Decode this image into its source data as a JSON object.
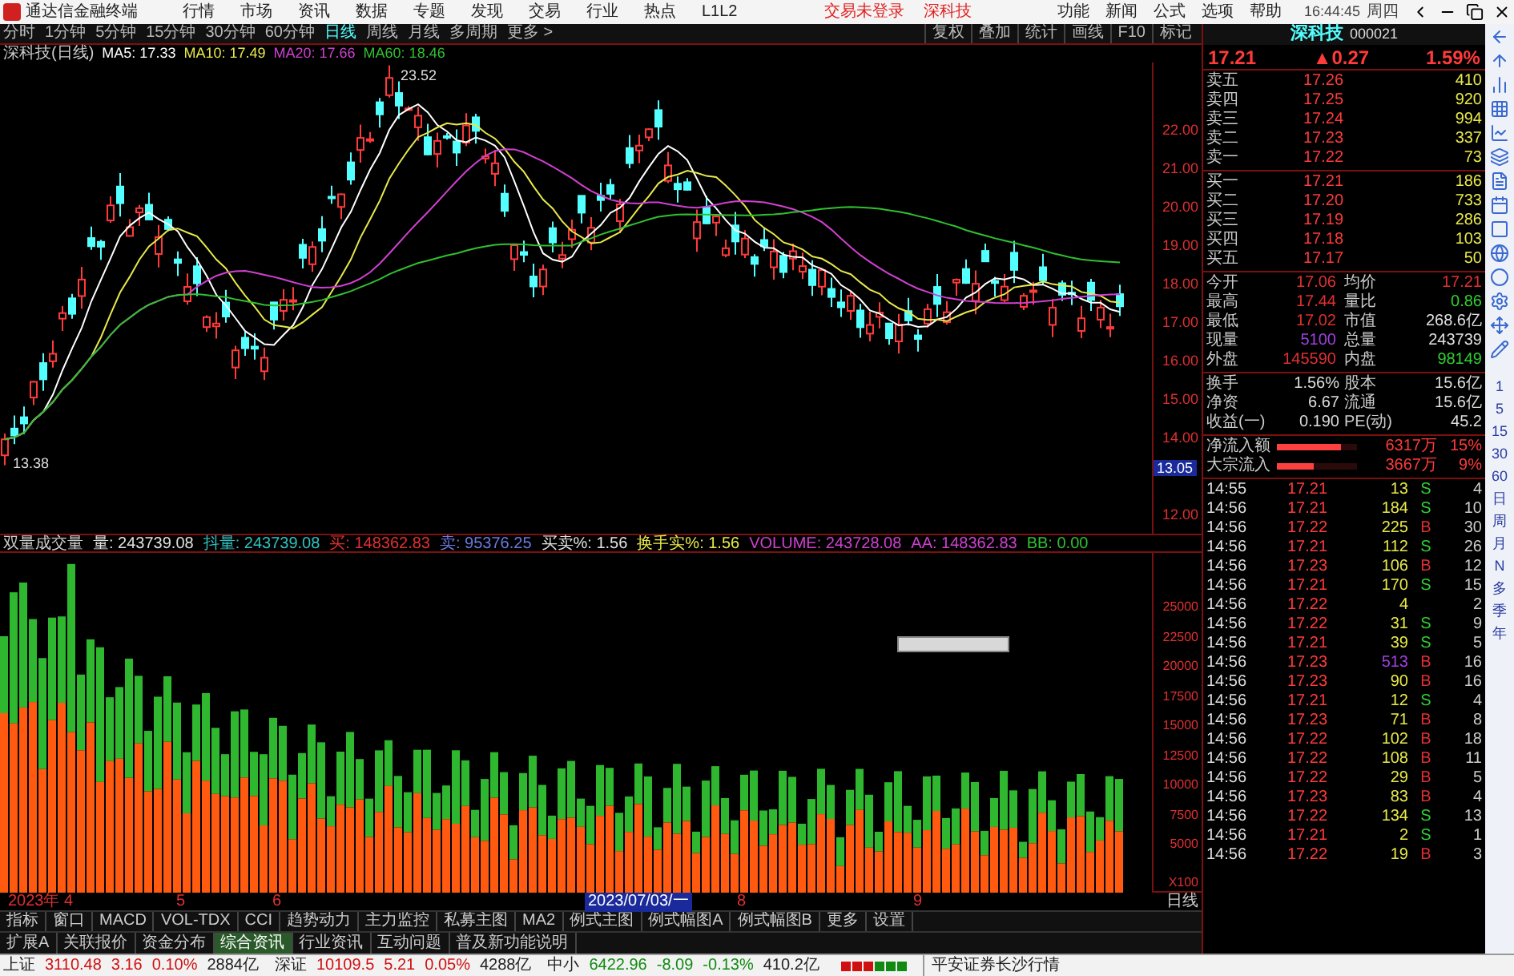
{
  "menu_bar": {
    "app_title": "通达信金融终端",
    "menus": [
      "行情",
      "市场",
      "资讯",
      "数据",
      "专题",
      "发现",
      "交易",
      "行业",
      "热点",
      "L1L2"
    ],
    "alerts": [
      "交易未登录",
      "深科技"
    ],
    "right_menus": [
      "功能",
      "新闻",
      "公式",
      "选项",
      "帮助"
    ],
    "clock": "16:44:45",
    "weekday": "周四"
  },
  "toolbar": {
    "periods": [
      {
        "label": "分时",
        "selected": false
      },
      {
        "label": "1分钟",
        "selected": false
      },
      {
        "label": "5分钟",
        "selected": false
      },
      {
        "label": "15分钟",
        "selected": false
      },
      {
        "label": "30分钟",
        "selected": false
      },
      {
        "label": "60分钟",
        "selected": false
      },
      {
        "label": "日线",
        "selected": true
      },
      {
        "label": "周线",
        "selected": false
      },
      {
        "label": "月线",
        "selected": false
      },
      {
        "label": "多周期",
        "selected": false
      },
      {
        "label": "更多 >",
        "selected": false
      }
    ],
    "tools": [
      "复权",
      "叠加",
      "统计",
      "画线",
      "F10",
      "标记"
    ]
  },
  "chart": {
    "title": "深科技(日线)",
    "indicators": [
      {
        "label": "MA5: 17.33",
        "color": "#ffffff"
      },
      {
        "label": "MA10: 17.49",
        "color": "#e8e84a"
      },
      {
        "label": "MA20: 17.66",
        "color": "#d040d0"
      },
      {
        "label": "MA60: 18.46",
        "color": "#30c030"
      }
    ],
    "high_label": "23.52",
    "low_label": "13.38",
    "price_labels": [
      "22.00",
      "21.00",
      "20.00",
      "19.00",
      "18.00",
      "17.00",
      "16.00",
      "15.00",
      "14.00",
      "12.00"
    ],
    "current_price_tag": "13.05"
  },
  "volume_chart": {
    "title": "双量成交量",
    "stats": [
      {
        "label": "量: 243739.08",
        "color": "#e0e0e0"
      },
      {
        "label": "抖量: 243739.08",
        "color": "#30c0c0"
      },
      {
        "label": "买: 148362.83",
        "color": "#e03030"
      },
      {
        "label": "卖: 95376.25",
        "color": "#6a7ae0"
      },
      {
        "label": "买卖%: 1.56",
        "color": "#e0e0e0"
      },
      {
        "label": "换手实%: 1.56",
        "color": "#e8e84a"
      },
      {
        "label": "VOLUME: 243728.08",
        "color": "#d040d0"
      },
      {
        "label": "AA: 148362.83",
        "color": "#d040d0"
      },
      {
        "label": "BB: 0.00",
        "color": "#30c030"
      }
    ],
    "axis_labels": [
      "25000",
      "22500",
      "20000",
      "17500",
      "15000",
      "12500",
      "10000",
      "7500",
      "5000"
    ],
    "unit": "X100"
  },
  "date_axis": {
    "labels": [
      "2023年",
      "4",
      "5",
      "6",
      "2023/07/03/一",
      "8",
      "9"
    ],
    "period": "日线"
  },
  "bottom_tabs": {
    "row1": [
      {
        "label": "指标",
        "selected": false
      },
      {
        "label": "窗口",
        "selected": false
      },
      {
        "label": "MACD",
        "selected": false
      },
      {
        "label": "VOL-TDX",
        "selected": false
      },
      {
        "label": "CCI",
        "selected": false
      },
      {
        "label": "趋势动力",
        "selected": false
      },
      {
        "label": "主力监控",
        "selected": false
      },
      {
        "label": "私募主图",
        "selected": false
      },
      {
        "label": "MA2",
        "selected": false
      },
      {
        "label": "例式主图",
        "selected": false
      },
      {
        "label": "例式幅图A",
        "selected": false
      },
      {
        "label": "例式幅图B",
        "selected": false
      },
      {
        "label": "更多",
        "selected": false
      },
      {
        "label": "设置",
        "selected": false
      }
    ],
    "row2": [
      {
        "label": "扩展A",
        "selected": false
      },
      {
        "label": "关联报价",
        "selected": false
      },
      {
        "label": "资金分布",
        "selected": false
      },
      {
        "label": "综合资讯",
        "selected": true
      },
      {
        "label": "行业资讯",
        "selected": false
      },
      {
        "label": "互动问题",
        "selected": false
      },
      {
        "label": "普及新功能说明",
        "selected": false
      }
    ]
  },
  "quote_panel": {
    "name": "深科技",
    "code": "000021",
    "price": "17.21",
    "change": "▲0.27",
    "percent": "1.59%",
    "asks": [
      {
        "label": "卖五",
        "price": "17.26",
        "volume": "410"
      },
      {
        "label": "卖四",
        "price": "17.25",
        "volume": "920"
      },
      {
        "label": "卖三",
        "price": "17.24",
        "volume": "994"
      },
      {
        "label": "卖二",
        "price": "17.23",
        "volume": "337"
      },
      {
        "label": "卖一",
        "price": "17.22",
        "volume": "73"
      }
    ],
    "bids": [
      {
        "label": "买一",
        "price": "17.21",
        "volume": "186"
      },
      {
        "label": "买二",
        "price": "17.20",
        "volume": "733"
      },
      {
        "label": "买三",
        "price": "17.19",
        "volume": "286"
      },
      {
        "label": "买四",
        "price": "17.18",
        "volume": "103"
      },
      {
        "label": "买五",
        "price": "17.17",
        "volume": "50"
      }
    ],
    "stats": [
      {
        "label": "今开",
        "value": "17.06",
        "color": "#e03030"
      },
      {
        "label": "均价",
        "value": "17.21",
        "color": "#e03030"
      },
      {
        "label": "最高",
        "value": "17.44",
        "color": "#e03030"
      },
      {
        "label": "量比",
        "value": "0.86",
        "color": "#30d030"
      },
      {
        "label": "最低",
        "value": "17.02",
        "color": "#e03030"
      },
      {
        "label": "市值",
        "value": "268.6亿",
        "color": "#e0e0e0"
      },
      {
        "label": "现量",
        "value": "5100",
        "color": "#a040e0"
      },
      {
        "label": "总量",
        "value": "243739",
        "color": "#e0e0e0"
      },
      {
        "label": "外盘",
        "value": "145590",
        "color": "#e03030"
      },
      {
        "label": "内盘",
        "value": "98149",
        "color": "#30d030"
      }
    ],
    "finance": [
      {
        "label": "换手",
        "value": "1.56%",
        "label2": "股本",
        "value2": "15.6亿"
      },
      {
        "label": "净资",
        "value": "6.67",
        "label2": "流通",
        "value2": "15.6亿"
      },
      {
        "label": "收益(一)",
        "value": "0.190",
        "label2": "PE(动)",
        "value2": "45.2"
      }
    ],
    "flows": [
      {
        "label": "净流入额",
        "level": 0.8,
        "amount": "6317万",
        "percent": "15%"
      },
      {
        "label": "大宗流入",
        "level": 0.45,
        "amount": "3667万",
        "percent": "9%"
      }
    ],
    "ticks": [
      {
        "time": "14:55",
        "price": "17.21",
        "volume": "13",
        "side": "S",
        "kind": "sell",
        "count": "4"
      },
      {
        "time": "14:56",
        "price": "17.21",
        "volume": "184",
        "side": "S",
        "kind": "sell",
        "count": "10"
      },
      {
        "time": "14:56",
        "price": "17.22",
        "volume": "225",
        "side": "B",
        "kind": "buy",
        "count": "30"
      },
      {
        "time": "14:56",
        "price": "17.21",
        "volume": "112",
        "side": "S",
        "kind": "sell",
        "count": "26"
      },
      {
        "time": "14:56",
        "price": "17.23",
        "volume": "106",
        "side": "B",
        "kind": "buy",
        "count": "12"
      },
      {
        "time": "14:56",
        "price": "17.21",
        "volume": "170",
        "side": "S",
        "kind": "sell",
        "count": "15"
      },
      {
        "time": "14:56",
        "price": "17.22",
        "volume": "4",
        "kind": "neutral",
        "count": "2"
      },
      {
        "time": "14:56",
        "price": "17.22",
        "volume": "31",
        "side": "S",
        "kind": "sell",
        "count": "9"
      },
      {
        "time": "14:56",
        "price": "17.21",
        "volume": "39",
        "side": "S",
        "kind": "sell",
        "count": "5"
      },
      {
        "time": "14:56",
        "price": "17.23",
        "volume": "513",
        "side": "B",
        "kind": "big-buy",
        "count": "16"
      },
      {
        "time": "14:56",
        "price": "17.23",
        "volume": "90",
        "side": "B",
        "kind": "buy",
        "count": "16"
      },
      {
        "time": "14:56",
        "price": "17.21",
        "volume": "12",
        "side": "S",
        "kind": "sell",
        "count": "4"
      },
      {
        "time": "14:56",
        "price": "17.23",
        "volume": "71",
        "side": "B",
        "kind": "buy",
        "count": "8"
      },
      {
        "time": "14:56",
        "price": "17.22",
        "volume": "102",
        "side": "B",
        "kind": "buy",
        "count": "18"
      },
      {
        "time": "14:56",
        "price": "17.22",
        "volume": "108",
        "side": "B",
        "kind": "buy",
        "count": "11"
      },
      {
        "time": "14:56",
        "price": "17.22",
        "volume": "29",
        "side": "B",
        "kind": "buy",
        "count": "5"
      },
      {
        "time": "14:56",
        "price": "17.23",
        "volume": "83",
        "side": "B",
        "kind": "buy",
        "count": "4"
      },
      {
        "time": "14:56",
        "price": "17.22",
        "volume": "134",
        "side": "S",
        "kind": "sell",
        "count": "13"
      },
      {
        "time": "14:56",
        "price": "17.21",
        "volume": "2",
        "side": "S",
        "kind": "sell",
        "count": "1"
      },
      {
        "time": "14:56",
        "price": "17.22",
        "volume": "19",
        "side": "B",
        "kind": "buy",
        "count": "3"
      }
    ]
  },
  "side_strip": {
    "periods": [
      "1",
      "5",
      "15",
      "30",
      "60",
      "日",
      "周",
      "月",
      "N",
      "多",
      "季",
      "年"
    ]
  },
  "status_bar": {
    "indices": [
      {
        "name": "上证",
        "value": "3110.48",
        "change": "3.16",
        "percent": "0.10%",
        "amount": "2884亿",
        "color": "#d01010"
      },
      {
        "name": "深证",
        "value": "10109.5",
        "change": "5.21",
        "percent": "0.05%",
        "amount": "4288亿",
        "color": "#d01010"
      },
      {
        "name": "中小",
        "value": "6422.96",
        "change": "-8.09",
        "percent": "-0.13%",
        "amount": "410.2亿",
        "color": "#108a10"
      }
    ],
    "broker": "平安证券长沙行情"
  }
}
